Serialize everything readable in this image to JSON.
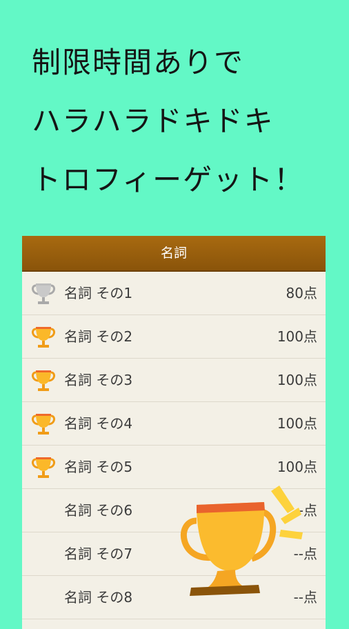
{
  "headline": {
    "line1": "制限時間ありで",
    "line2": "ハラハラドキドキ",
    "line3": "トロフィーゲット！"
  },
  "panel": {
    "title": "名詞",
    "rows": [
      {
        "label": "名詞 その1",
        "score": "80点",
        "trophy": "silver"
      },
      {
        "label": "名詞 その2",
        "score": "100点",
        "trophy": "gold"
      },
      {
        "label": "名詞 その3",
        "score": "100点",
        "trophy": "gold"
      },
      {
        "label": "名詞 その4",
        "score": "100点",
        "trophy": "gold"
      },
      {
        "label": "名詞 その5",
        "score": "100点",
        "trophy": "gold"
      },
      {
        "label": "名詞 その6",
        "score": "--点",
        "trophy": "none"
      },
      {
        "label": "名詞 その7",
        "score": "--点",
        "trophy": "none"
      },
      {
        "label": "名詞 その8",
        "score": "--点",
        "trophy": "none"
      }
    ]
  },
  "colors": {
    "background": "#63f8c6",
    "header": "#9a600d",
    "gold": "#fbb829",
    "silver": "#c9c9c9"
  }
}
